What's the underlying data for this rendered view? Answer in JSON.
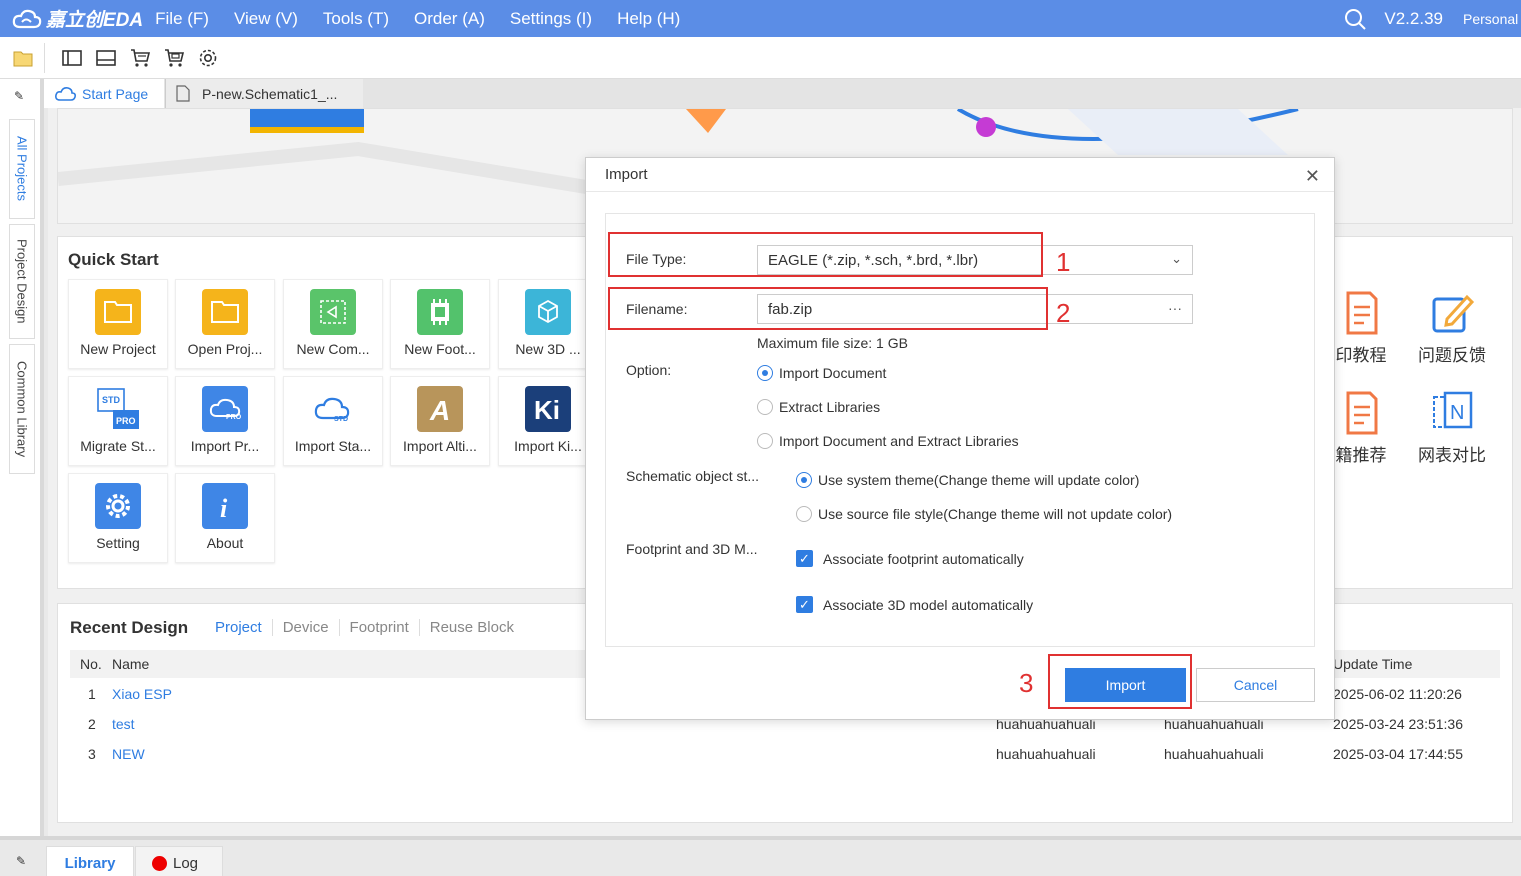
{
  "app": {
    "logo_text": "嘉立创EDA",
    "menu": [
      "File (F)",
      "View (V)",
      "Tools (T)",
      "Order (A)",
      "Settings (I)",
      "Help (H)"
    ],
    "version": "V2.2.39",
    "account": "Personal"
  },
  "sidebar": {
    "tabs": [
      "All Projects",
      "Project Design",
      "Common Library"
    ]
  },
  "doc_tabs": [
    "Start Page",
    "P-new.Schematic1_..."
  ],
  "quick_start": {
    "title": "Quick Start",
    "items": [
      "New Project",
      "Open Proj...",
      "New Com...",
      "New Foot...",
      "New 3D ...",
      "Migrate St...",
      "Import Pr...",
      "Import Sta...",
      "Import Alti...",
      "Import Ki...",
      "Setting",
      "About"
    ],
    "right_items": [
      "印教程",
      "问题反馈",
      "籍推荐",
      "网表对比"
    ]
  },
  "recent": {
    "title": "Recent Design",
    "tabs": [
      "Project",
      "Device",
      "Footprint",
      "Reuse Block"
    ],
    "columns": {
      "no": "No.",
      "name": "Name",
      "update": "Update Time"
    },
    "rows": [
      {
        "no": "1",
        "name": "Xiao ESP",
        "owner": "",
        "creator": "",
        "time": "2025-06-02 11:20:26"
      },
      {
        "no": "2",
        "name": "test",
        "owner": "huahuahuahuali",
        "creator": "huahuahuahuali",
        "time": "2025-03-24 23:51:36"
      },
      {
        "no": "3",
        "name": "NEW",
        "owner": "huahuahuahuali",
        "creator": "huahuahuahuali",
        "time": "2025-03-04 17:44:55"
      }
    ]
  },
  "bottom_tabs": {
    "library": "Library",
    "log": "Log"
  },
  "dialog": {
    "title": "Import",
    "file_type_label": "File Type:",
    "file_type_value": "EAGLE (*.zip, *.sch, *.brd, *.lbr)",
    "filename_label": "Filename:",
    "filename_value": "fab.zip",
    "browse": "···",
    "max_size": "Maximum file size: 1 GB",
    "option_label": "Option:",
    "options": [
      {
        "label": "Import Document",
        "checked": true
      },
      {
        "label": "Extract Libraries",
        "checked": false
      },
      {
        "label": "Import Document and Extract Libraries",
        "checked": false
      }
    ],
    "schematic_label": "Schematic object st...",
    "schematic_options": [
      {
        "label": "Use system theme(Change theme will update color)",
        "checked": true
      },
      {
        "label": "Use source file style(Change theme will not update color)",
        "checked": false
      }
    ],
    "footprint_label": "Footprint and 3D M...",
    "checks": [
      "Associate footprint automatically",
      "Associate 3D model automatically"
    ],
    "import_button": "Import",
    "cancel_button": "Cancel",
    "annotations": [
      "1",
      "2",
      "3"
    ]
  },
  "colors": {
    "accent": "#2f7de1",
    "menubar": "#5b8de6",
    "annotation": "#e03131"
  }
}
